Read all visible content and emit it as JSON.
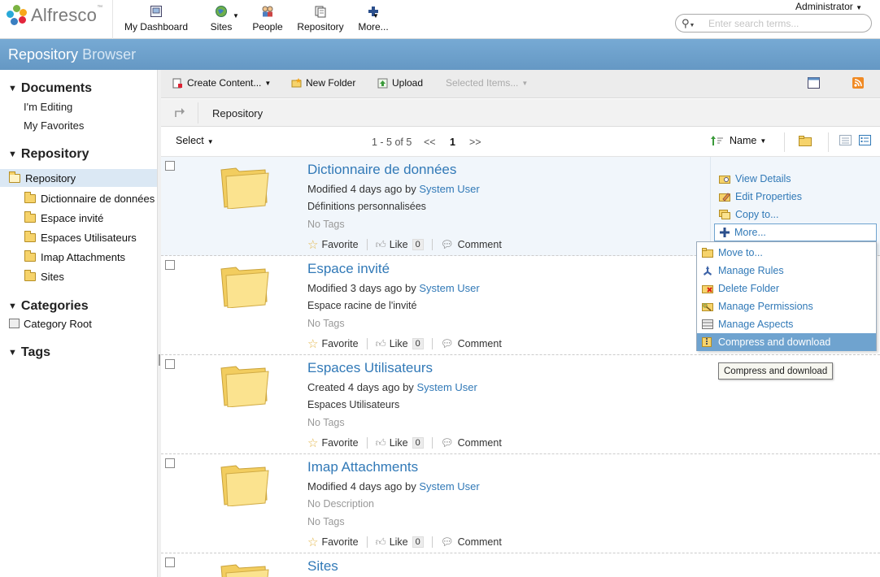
{
  "header": {
    "logo_text": "Alfresco",
    "logo_tm": "™",
    "nav": [
      {
        "label": "My Dashboard",
        "icon": "dashboard-icon"
      },
      {
        "label": "Sites",
        "icon": "globe-icon"
      },
      {
        "label": "People",
        "icon": "people-icon"
      },
      {
        "label": "Repository",
        "icon": "repository-icon"
      },
      {
        "label": "More...",
        "icon": "plus-icon"
      }
    ],
    "user_menu": "Administrator",
    "search_placeholder": "Enter search terms..."
  },
  "page_title": {
    "part1": "Repository",
    "part2": "Browser"
  },
  "sidebar": {
    "documents_heading": "Documents",
    "documents_links": [
      "I'm Editing",
      "My Favorites"
    ],
    "repository_heading": "Repository",
    "tree_root": "Repository",
    "tree_items": [
      "Dictionnaire de données",
      "Espace invité",
      "Espaces Utilisateurs",
      "Imap Attachments",
      "Sites"
    ],
    "categories_heading": "Categories",
    "category_root": "Category Root",
    "tags_heading": "Tags"
  },
  "toolbar": {
    "create_content": "Create Content...",
    "new_folder": "New Folder",
    "upload": "Upload",
    "selected_items": "Selected Items..."
  },
  "breadcrumb": {
    "current": "Repository"
  },
  "listbar": {
    "select": "Select",
    "pagination_text": "1 - 5 of 5",
    "prev": "<<",
    "page": "1",
    "next": ">>",
    "sort_label": "Name"
  },
  "rows": [
    {
      "name": "Dictionnaire de données",
      "meta_prefix": "Modified 4 days ago by",
      "user": "System User",
      "description": "Définitions personnalisées",
      "description_muted": false,
      "tags": "No Tags",
      "favorite": "Favorite",
      "like": "Like",
      "like_count": "0",
      "comment": "Comment"
    },
    {
      "name": "Espace invité",
      "meta_prefix": "Modified 3 days ago by",
      "user": "System User",
      "description": "Espace racine de l'invité",
      "description_muted": false,
      "tags": "No Tags",
      "favorite": "Favorite",
      "like": "Like",
      "like_count": "0",
      "comment": "Comment"
    },
    {
      "name": "Espaces Utilisateurs",
      "meta_prefix": "Created 4 days ago by",
      "user": "System User",
      "description": "Espaces Utilisateurs",
      "description_muted": false,
      "tags": "No Tags",
      "favorite": "Favorite",
      "like": "Like",
      "like_count": "0",
      "comment": "Comment"
    },
    {
      "name": "Imap Attachments",
      "meta_prefix": "Modified 4 days ago by",
      "user": "System User",
      "description": "No Description",
      "description_muted": true,
      "tags": "No Tags",
      "favorite": "Favorite",
      "like": "Like",
      "like_count": "0",
      "comment": "Comment"
    },
    {
      "name": "Sites"
    }
  ],
  "row_actions": {
    "view_details": "View Details",
    "edit_properties": "Edit Properties",
    "copy_to": "Copy to...",
    "more": "More..."
  },
  "more_menu": [
    {
      "label": "Move to...",
      "icon": "move-folder-icon"
    },
    {
      "label": "Manage Rules",
      "icon": "rules-icon"
    },
    {
      "label": "Delete Folder",
      "icon": "delete-folder-icon"
    },
    {
      "label": "Manage Permissions",
      "icon": "key-folder-icon"
    },
    {
      "label": "Manage Aspects",
      "icon": "aspects-icon"
    },
    {
      "label": "Compress and download",
      "icon": "zip-icon",
      "active": true
    }
  ],
  "tooltip": "Compress and download",
  "colors": {
    "accent": "#6fa3cf",
    "link": "#3179b7",
    "folder": "#f6d36b"
  }
}
